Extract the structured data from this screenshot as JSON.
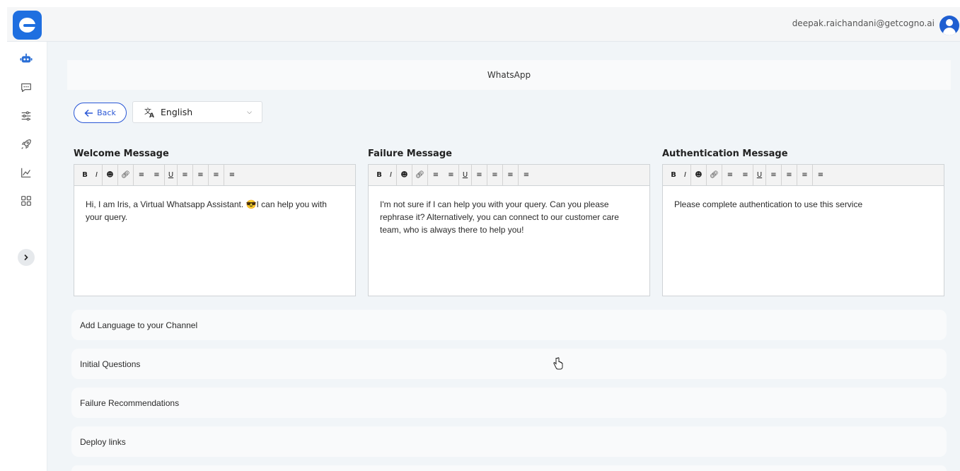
{
  "header": {
    "user_email": "deepak.raichandani@getcogno.ai"
  },
  "sidebar": {
    "items": [
      {
        "icon": "bot-icon"
      },
      {
        "icon": "chat-icon"
      },
      {
        "icon": "sliders-icon"
      },
      {
        "icon": "rocket-icon"
      },
      {
        "icon": "analytics-icon"
      },
      {
        "icon": "apps-grid-icon"
      }
    ],
    "expand_icon": "chevron-right-icon"
  },
  "page": {
    "title": "WhatsApp",
    "back_label": "Back",
    "language": "English"
  },
  "editors": [
    {
      "label": "Welcome Message",
      "content": "Hi, I am Iris, a Virtual Whatsapp Assistant. 😎I can help you with your query."
    },
    {
      "label": "Failure Message",
      "content": "I'm not sure if I can help you with your query. Can you please rephrase it? Alternatively, you can connect to our customer care team, who is always there to help you!"
    },
    {
      "label": "Authentication Message",
      "content": "Please complete authentication to use this service"
    }
  ],
  "toolbar": {
    "bold": "B",
    "italic": "I",
    "underline": "U"
  },
  "accordions": [
    {
      "label": "Add Language to your Channel"
    },
    {
      "label": "Initial Questions"
    },
    {
      "label": "Failure Recommendations"
    },
    {
      "label": "Deploy links"
    }
  ],
  "colors": {
    "accent": "#2a57d6",
    "brand": "#1f6fe0",
    "sidebar_icon": "#2b6fd6"
  }
}
